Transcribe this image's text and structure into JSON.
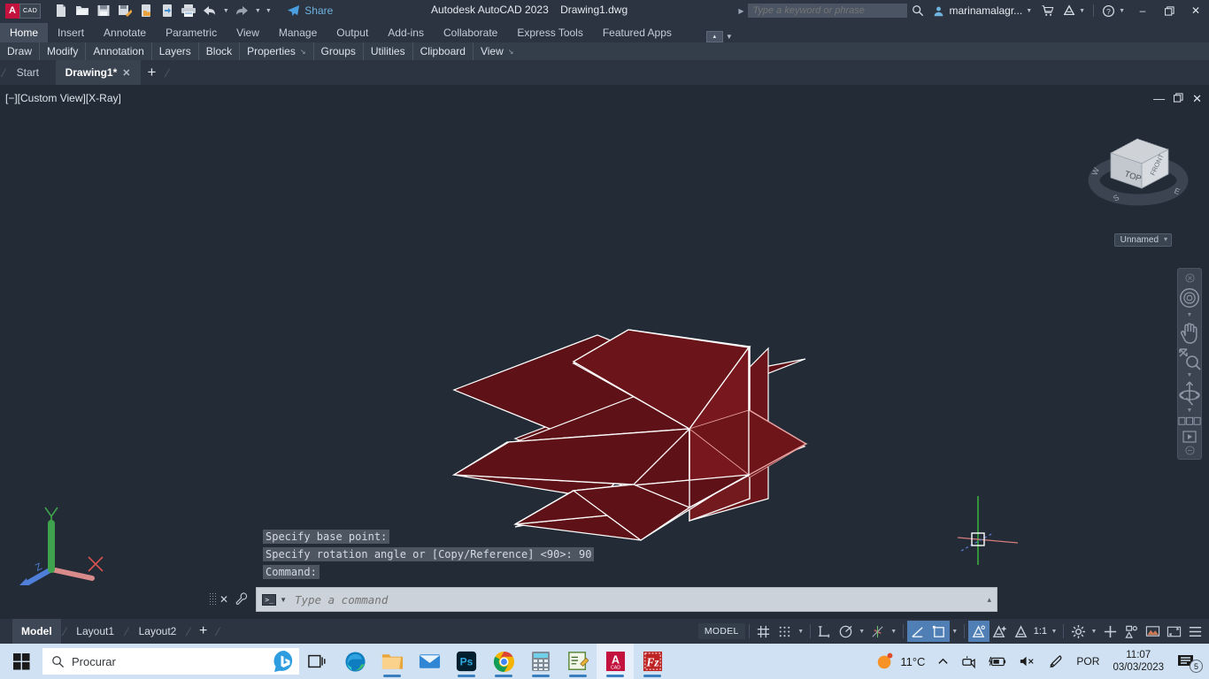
{
  "titlebar": {
    "logo_a": "A",
    "logo_cad": "CAD",
    "app_title": "Autodesk AutoCAD 2023",
    "file_title": "Drawing1.dwg",
    "share_label": "Share",
    "search_placeholder": "Type a keyword or phrase",
    "user_name": "marinamalagr...",
    "qat_items": [
      {
        "name": "new-drawing-icon",
        "tip": "New"
      },
      {
        "name": "open-drawing-icon",
        "tip": "Open"
      },
      {
        "name": "save-icon",
        "tip": "Save"
      },
      {
        "name": "save-as-icon",
        "tip": "Save As"
      },
      {
        "name": "open-from-web-icon",
        "tip": "Open from Web & Mobile"
      },
      {
        "name": "save-to-web-icon",
        "tip": "Save to Web & Mobile"
      },
      {
        "name": "plot-icon",
        "tip": "Plot"
      },
      {
        "name": "undo-icon",
        "tip": "Undo"
      },
      {
        "name": "redo-icon",
        "tip": "Redo"
      }
    ],
    "window_buttons": {
      "minimize": "–",
      "restore": "❐",
      "close": "✕"
    }
  },
  "ribbon": {
    "tabs": [
      {
        "label": "Home",
        "active": true
      },
      {
        "label": "Insert",
        "active": false
      },
      {
        "label": "Annotate",
        "active": false
      },
      {
        "label": "Parametric",
        "active": false
      },
      {
        "label": "View",
        "active": false
      },
      {
        "label": "Manage",
        "active": false
      },
      {
        "label": "Output",
        "active": false
      },
      {
        "label": "Add-ins",
        "active": false
      },
      {
        "label": "Collaborate",
        "active": false
      },
      {
        "label": "Express Tools",
        "active": false
      },
      {
        "label": "Featured Apps",
        "active": false
      }
    ],
    "panels": [
      {
        "label": "Draw",
        "arrow": ""
      },
      {
        "label": "Modify",
        "arrow": ""
      },
      {
        "label": "Annotation",
        "arrow": ""
      },
      {
        "label": "Layers",
        "arrow": ""
      },
      {
        "label": "Block",
        "arrow": ""
      },
      {
        "label": "Properties",
        "arrow": "↘"
      },
      {
        "label": "Groups",
        "arrow": ""
      },
      {
        "label": "Utilities",
        "arrow": ""
      },
      {
        "label": "Clipboard",
        "arrow": ""
      },
      {
        "label": "View",
        "arrow": "↘"
      }
    ]
  },
  "filetabs": {
    "tabs": [
      {
        "label": "Start",
        "active": false,
        "closable": false
      },
      {
        "label": "Drawing1*",
        "active": true,
        "closable": true
      }
    ],
    "close_glyph": "✕",
    "new_tab_glyph": "+"
  },
  "viewport": {
    "label": "[−][Custom View][X-Ray]",
    "window_buttons": {
      "minimize": "—",
      "maximize": "❐",
      "close": "✕"
    },
    "viewcube": {
      "top_face": "TOP",
      "front_face": "FRONT",
      "compass": [
        "W",
        "S",
        "E"
      ]
    },
    "view_name": "Unnamed",
    "navbar_items": [
      {
        "name": "navbar-close-icon",
        "label": "close"
      },
      {
        "name": "steering-wheels-icon",
        "label": "SteeringWheels"
      },
      {
        "name": "pan-hand-icon",
        "label": "Pan"
      },
      {
        "name": "zoom-extents-icon",
        "label": "Zoom"
      },
      {
        "name": "orbit-icon",
        "label": "Orbit"
      },
      {
        "name": "show-motion-icon",
        "label": "ShowMotion"
      }
    ],
    "ucs_axes": {
      "x": "X",
      "y": "Y",
      "z": "Z"
    },
    "colors": {
      "canvas": "#222b36",
      "face_fill": "#6b1419",
      "face_edge": "#ffffff",
      "axis_x": "#d9534f",
      "axis_y": "#3fa34d",
      "axis_z": "#4f7fd9"
    }
  },
  "command": {
    "history": [
      "Specify base point:",
      "Specify rotation angle or [Copy/Reference] <90>: 90",
      "Command:"
    ],
    "input_placeholder": "Type a command",
    "input_value": "",
    "close_glyph": "✕",
    "expand_glyph": "▴"
  },
  "statusbar": {
    "layout_tabs": [
      {
        "label": "Model",
        "active": true
      },
      {
        "label": "Layout1",
        "active": false
      },
      {
        "label": "Layout2",
        "active": false
      }
    ],
    "add_layout_glyph": "+",
    "space_label": "MODEL",
    "annotation_scale": "1:1",
    "tools": [
      {
        "name": "grid-display-button",
        "label": "Grid Display",
        "on": false
      },
      {
        "name": "snap-mode-button",
        "label": "Snap Mode",
        "on": false
      },
      {
        "name": "ortho-mode-button",
        "label": "Ortho Mode",
        "on": false
      },
      {
        "name": "polar-tracking-button",
        "label": "Polar Tracking",
        "on": false
      },
      {
        "name": "object-snap-tracking-button",
        "label": "Object Snap Tracking",
        "on": false
      },
      {
        "name": "object-snap-button",
        "label": "Object Snap",
        "on": true
      },
      {
        "name": "lineweight-button",
        "label": "Show/Hide Lineweight",
        "on": true
      },
      {
        "name": "annotation-visibility-button",
        "label": "Annotation Visibility",
        "on": true
      },
      {
        "name": "autoscale-button",
        "label": "Auto Scale",
        "on": false
      },
      {
        "name": "annotation-monitor-button",
        "label": "Annotation Monitor",
        "on": false
      },
      {
        "name": "workspace-switch-button",
        "label": "Workspace Switching",
        "on": false
      },
      {
        "name": "isolate-objects-button",
        "label": "Isolate Objects",
        "on": false
      },
      {
        "name": "hardware-accel-button",
        "label": "Hardware Acceleration",
        "on": false
      },
      {
        "name": "clean-screen-button",
        "label": "Clean Screen",
        "on": false
      },
      {
        "name": "customization-button",
        "label": "Customization",
        "on": false
      }
    ]
  },
  "taskbar": {
    "search_placeholder": "Procurar",
    "apps": [
      {
        "name": "task-view-icon",
        "label": "Task View",
        "running": false,
        "active": false
      },
      {
        "name": "microsoft-edge-icon",
        "label": "Microsoft Edge",
        "running": true,
        "active": false
      },
      {
        "name": "file-explorer-icon",
        "label": "File Explorer",
        "running": true,
        "active": false
      },
      {
        "name": "mail-icon",
        "label": "Mail",
        "running": false,
        "active": false
      },
      {
        "name": "photoshop-icon",
        "label": "Adobe Photoshop",
        "running": true,
        "active": false
      },
      {
        "name": "google-chrome-icon",
        "label": "Google Chrome",
        "running": true,
        "active": false
      },
      {
        "name": "calculator-icon",
        "label": "Calculator",
        "running": true,
        "active": false
      },
      {
        "name": "notepad-editor-icon",
        "label": "Editor",
        "running": true,
        "active": false
      },
      {
        "name": "autocad-icon",
        "label": "AutoCAD",
        "running": true,
        "active": true
      },
      {
        "name": "filezilla-icon",
        "label": "FileZilla",
        "running": true,
        "active": false
      }
    ],
    "tray": {
      "weather_temp": "11°C",
      "language": "POR",
      "time": "11:07",
      "date": "03/03/2023",
      "notification_count": "5"
    }
  }
}
